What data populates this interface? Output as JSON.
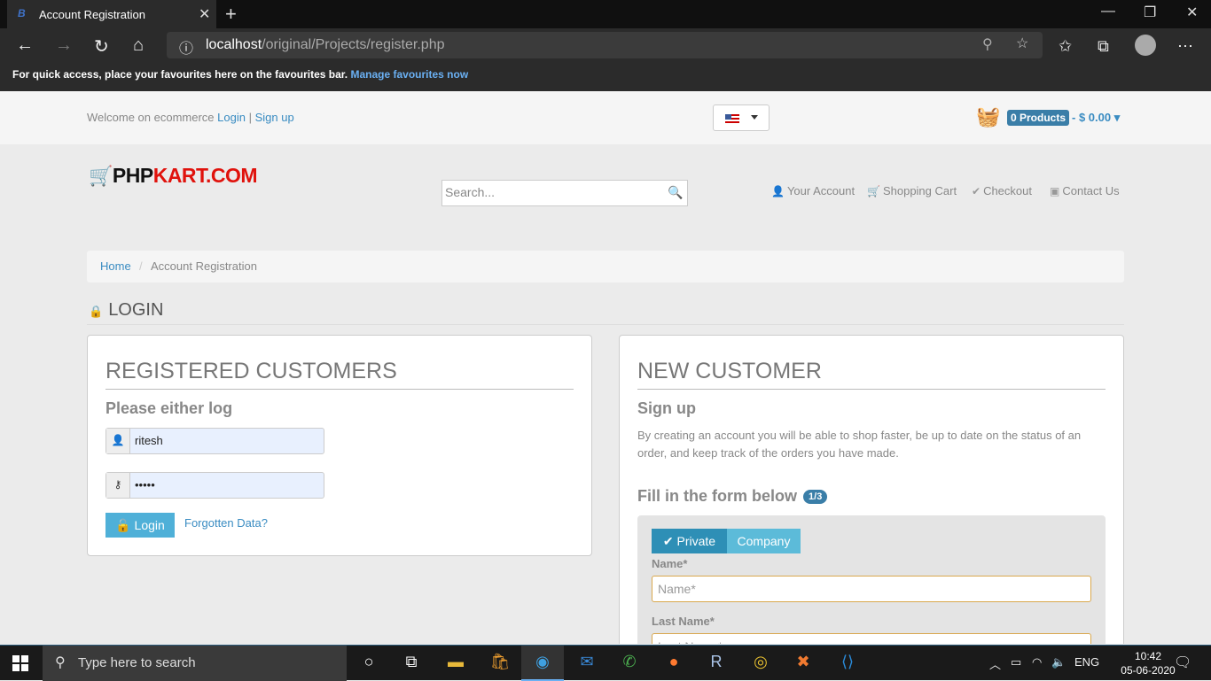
{
  "browser": {
    "tab_title": "Account Registration",
    "tab_favicon": "B",
    "url_host": "localhost",
    "url_path": "/original/Projects/register.php",
    "favbar_text": "For quick access, place your favourites here on the favourites bar.",
    "favbar_link": "Manage favourites now"
  },
  "topbar": {
    "welcome_text": "Welcome on ecommerce",
    "login_link": "Login",
    "separator": "|",
    "signup_link": "Sign up",
    "cart_badge": "0 Products",
    "cart_total": "- $ 0.00"
  },
  "header": {
    "logo_black": "PHP",
    "logo_red": "KART.COM",
    "search_placeholder": "Search...",
    "nav": [
      {
        "label": "Your Account",
        "icon": "user-icon"
      },
      {
        "label": "Shopping Cart",
        "icon": "cart-icon"
      },
      {
        "label": "Checkout",
        "icon": "check-circle-icon"
      },
      {
        "label": "Contact Us",
        "icon": "contact-icon"
      }
    ]
  },
  "breadcrumb": {
    "home": "Home",
    "sep": "/",
    "current": "Account Registration"
  },
  "login_section": {
    "title": "LOGIN"
  },
  "registered": {
    "heading": "REGISTERED CUSTOMERS",
    "subheading": "Please either log",
    "username_value": "ritesh",
    "password_value": "•••••",
    "login_button": "Login",
    "forgot_link": "Forgotten Data?"
  },
  "new_customer": {
    "heading": "NEW CUSTOMER",
    "subheading": "Sign up",
    "description": "By creating an account you will be able to shop faster, be up to date on the status of an order, and keep track of the orders you have made.",
    "fill_title": "Fill in the form below",
    "step_badge": "1/3",
    "toggle_private": "Private",
    "toggle_company": "Company",
    "name_label": "Name*",
    "name_placeholder": "Name*",
    "lastname_label": "Last Name*",
    "lastname_placeholder": "Last Name*"
  },
  "taskbar": {
    "search_placeholder": "Type here to search",
    "lang": "ENG",
    "time": "10:42",
    "date": "05-06-2020"
  },
  "colors": {
    "accent_blue": "#3a8cc2",
    "logo_red": "#e0120c",
    "login_button": "#4fb0d8",
    "private_toggle": "#2e8fb6"
  }
}
